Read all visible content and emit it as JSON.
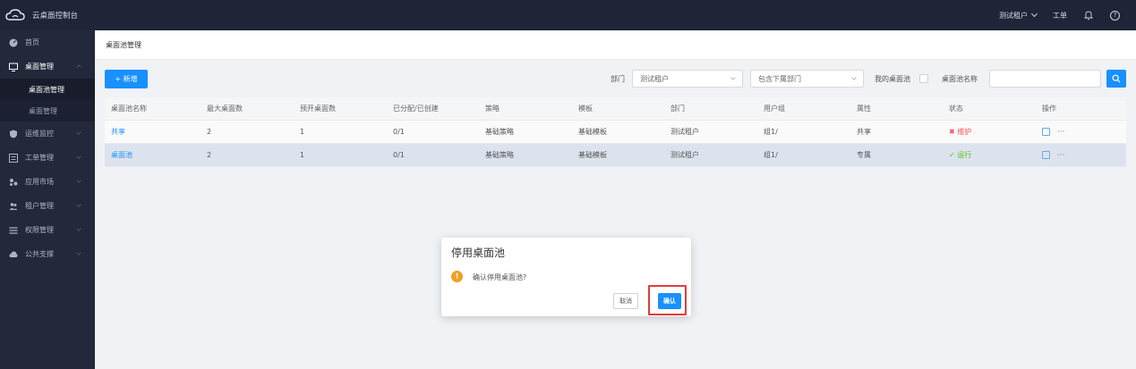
{
  "header": {
    "app_title": "云桌面控制台",
    "tenant_label": "测试租户",
    "workorder_label": "工单",
    "help_glyph": "?"
  },
  "sidebar": {
    "items": [
      {
        "label": "首页",
        "icon": "dashboard-icon"
      },
      {
        "label": "桌面管理",
        "icon": "monitor-icon",
        "expanded": true,
        "children": [
          {
            "label": "桌面池管理",
            "active": true
          },
          {
            "label": "桌面管理",
            "active": false
          }
        ]
      },
      {
        "label": "运维监控",
        "icon": "shield-icon"
      },
      {
        "label": "工单管理",
        "icon": "list-icon"
      },
      {
        "label": "应用市场",
        "icon": "apps-icon"
      },
      {
        "label": "租户管理",
        "icon": "users-icon"
      },
      {
        "label": "权限管理",
        "icon": "permission-icon"
      },
      {
        "label": "公共支撑",
        "icon": "cloud-icon"
      }
    ]
  },
  "breadcrumb": {
    "label": "桌面池管理"
  },
  "toolbar": {
    "new_button": "+ 新增",
    "dept_label": "部门",
    "dept_value": "测试租户",
    "include_sub_value": "包含下属部门",
    "my_pool_label": "我的桌面池",
    "pool_name_label": "桌面池名称",
    "pool_name_value": ""
  },
  "table": {
    "columns": [
      "桌面池名称",
      "最大桌面数",
      "预开桌面数",
      "已分配/已创建",
      "策略",
      "模板",
      "部门",
      "用户组",
      "属性",
      "状态",
      "操作"
    ],
    "rows": [
      {
        "name": "共享",
        "max": "2",
        "pre": "1",
        "alloc": "0/1",
        "policy": "基础策略",
        "template": "基础模板",
        "dept": "测试租户",
        "group": "组1/",
        "attr": "共享",
        "status": "维护",
        "status_icon": "✖"
      },
      {
        "name": "桌面池",
        "max": "2",
        "pre": "1",
        "alloc": "0/1",
        "policy": "基础策略",
        "template": "基础模板",
        "dept": "测试租户",
        "group": "组1/",
        "attr": "专属",
        "status": "运行",
        "status_icon": "✓"
      }
    ],
    "more_glyph": "···"
  },
  "modal": {
    "title": "停用桌面池",
    "message": "确认停用桌面池?",
    "cancel_label": "取消",
    "confirm_label": "确认",
    "warn_glyph": "!"
  }
}
